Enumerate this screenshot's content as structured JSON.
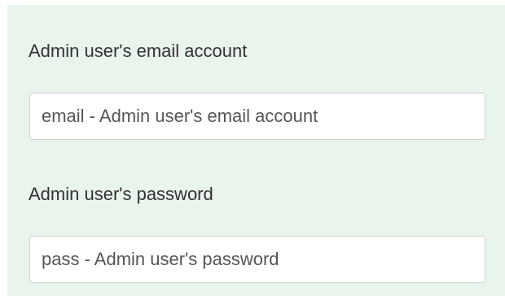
{
  "form": {
    "email_label": "Admin user's email account",
    "email_placeholder": "email - Admin user's email account",
    "email_value": "",
    "password_label": "Admin user's password",
    "password_placeholder": "pass - Admin user's password",
    "password_value": ""
  },
  "colors": {
    "panel_background": "#e8f4ec",
    "input_border": "#cfd6d2",
    "label_text": "#333333",
    "placeholder_text": "#555555"
  }
}
